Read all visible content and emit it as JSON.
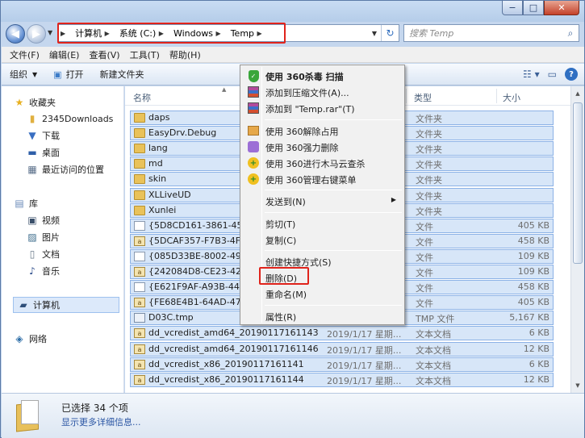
{
  "window": {
    "caption": {
      "minimize": "−",
      "maximize": "□",
      "close": "✕"
    }
  },
  "navigation": {
    "back_glyph": "◀",
    "forward_glyph": "▶",
    "breadcrumb": [
      "计算机",
      "系统 (C:)",
      "Windows",
      "Temp"
    ],
    "address_dropdown": "▼",
    "refresh_glyph": "↻"
  },
  "search": {
    "placeholder": "搜索 Temp",
    "icon": "magnifier-icon"
  },
  "menubar": [
    "文件(F)",
    "编辑(E)",
    "查看(V)",
    "工具(T)",
    "帮助(H)"
  ],
  "toolbar": {
    "organize": "组织",
    "open": "打开",
    "new_folder": "新建文件夹"
  },
  "sidebar": {
    "favorites": "收藏夹",
    "fav_items": [
      "2345Downloads",
      "下载",
      "桌面",
      "最近访问的位置"
    ],
    "library": "库",
    "lib_items": [
      "视频",
      "图片",
      "文档",
      "音乐"
    ],
    "computer": "计算机",
    "network": "网络"
  },
  "columns": {
    "name": "名称",
    "type": "类型",
    "size": "大小"
  },
  "files": [
    {
      "name": "daps",
      "date": "",
      "type": "文件夹",
      "size": "",
      "kind": "folder"
    },
    {
      "name": "EasyDrv.Debug",
      "date": "",
      "type": "文件夹",
      "size": "",
      "kind": "folder"
    },
    {
      "name": "lang",
      "date": "",
      "type": "文件夹",
      "size": "",
      "kind": "folder"
    },
    {
      "name": "md",
      "date": "",
      "type": "文件夹",
      "size": "",
      "kind": "folder"
    },
    {
      "name": "skin",
      "date": "",
      "type": "文件夹",
      "size": "",
      "kind": "folder"
    },
    {
      "name": "XLLiveUD",
      "date": "",
      "type": "文件夹",
      "size": "",
      "kind": "folder"
    },
    {
      "name": "Xunlei",
      "date": "",
      "type": "文件夹",
      "size": "",
      "kind": "folder"
    },
    {
      "name": "{5D8CD161-3861-45D",
      "date": "",
      "type": "文件",
      "size": "405 KB",
      "kind": "file"
    },
    {
      "name": "{5DCAF357-F7B3-4FC",
      "date": "",
      "type": "文件",
      "size": "458 KB",
      "kind": "lock"
    },
    {
      "name": "{085D33BE-8002-49C4",
      "date": "",
      "type": "文件",
      "size": "109 KB",
      "kind": "file"
    },
    {
      "name": "{242084D8-CE23-42B",
      "date": "",
      "type": "文件",
      "size": "109 KB",
      "kind": "lock"
    },
    {
      "name": "{E621F9AF-A93B-44B8",
      "date": "",
      "type": "文件",
      "size": "458 KB",
      "kind": "file"
    },
    {
      "name": "{FE68E4B1-64AD-471",
      "date": "",
      "type": "文件",
      "size": "405 KB",
      "kind": "lock"
    },
    {
      "name": "D03C.tmp",
      "date": "",
      "type": "TMP 文件",
      "size": "5,167 KB",
      "kind": "tmp"
    },
    {
      "name": "dd_vcredist_amd64_20190117161143",
      "date": "2019/1/17 星期...",
      "type": "文本文档",
      "size": "6 KB",
      "kind": "lock"
    },
    {
      "name": "dd_vcredist_amd64_20190117161146",
      "date": "2019/1/17 星期...",
      "type": "文本文档",
      "size": "12 KB",
      "kind": "lock"
    },
    {
      "name": "dd_vcredist_x86_20190117161141",
      "date": "2019/1/17 星期...",
      "type": "文本文档",
      "size": "6 KB",
      "kind": "lock"
    },
    {
      "name": "dd_vcredist_x86_20190117161144",
      "date": "2019/1/17 星期...",
      "type": "文本文档",
      "size": "12 KB",
      "kind": "lock"
    }
  ],
  "context_menu": [
    {
      "label": "使用 360杀毒 扫描",
      "icon": "shield",
      "bold": true
    },
    {
      "label": "添加到压缩文件(A)...",
      "icon": "rar"
    },
    {
      "label": "添加到 \"Temp.rar\"(T)",
      "icon": "rar"
    },
    {
      "sep": true
    },
    {
      "label": "使用 360解除占用",
      "icon": "orange"
    },
    {
      "label": "使用 360强力删除",
      "icon": "purple"
    },
    {
      "label": "使用 360进行木马云查杀",
      "icon": "yellow"
    },
    {
      "label": "使用 360管理右键菜单",
      "icon": "yellow"
    },
    {
      "sep": true
    },
    {
      "label": "发送到(N)",
      "icon": "",
      "submenu": true
    },
    {
      "sep": true
    },
    {
      "label": "剪切(T)",
      "icon": ""
    },
    {
      "label": "复制(C)",
      "icon": ""
    },
    {
      "sep": true
    },
    {
      "label": "创建快捷方式(S)",
      "icon": ""
    },
    {
      "label": "删除(D)",
      "icon": "",
      "highlighted": true
    },
    {
      "label": "重命名(M)",
      "icon": ""
    },
    {
      "sep": true
    },
    {
      "label": "属性(R)",
      "icon": ""
    }
  ],
  "status": {
    "selected": "已选择 34 个项",
    "details_link": "显示更多详细信息..."
  },
  "colors": {
    "highlight_red": "#e0231b",
    "selection_blue": "#d7e6f8"
  }
}
